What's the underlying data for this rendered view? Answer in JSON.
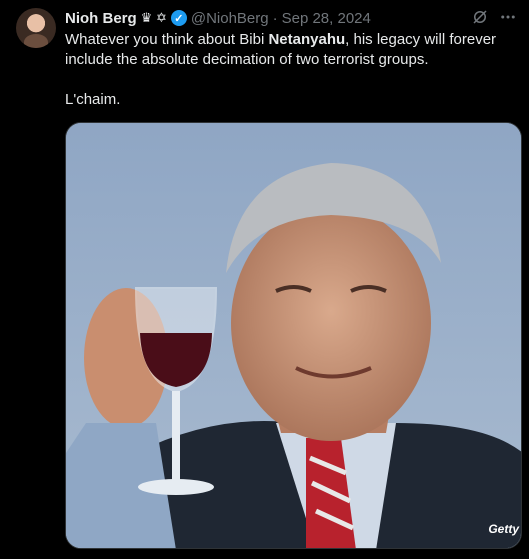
{
  "tweet": {
    "author_name": "Nioh Berg",
    "author_glyphs": "♛ ✡",
    "handle": "@NiohBerg",
    "separator": "·",
    "date": "Sep 28, 2024",
    "grok_icon": "grok-icon",
    "more_icon": "more-icon",
    "text_part1": "Whatever you think about Bibi ",
    "text_bold": "Netanyahu",
    "text_part2": ", his legacy will forever include the absolute decimation of two terrorist groups.",
    "text_line2": "L'chaim.",
    "media_credit": "Getty"
  },
  "colors": {
    "background": "#000000",
    "text": "#e7e9ea",
    "muted": "#71767b",
    "verified": "#1d9bf0"
  }
}
